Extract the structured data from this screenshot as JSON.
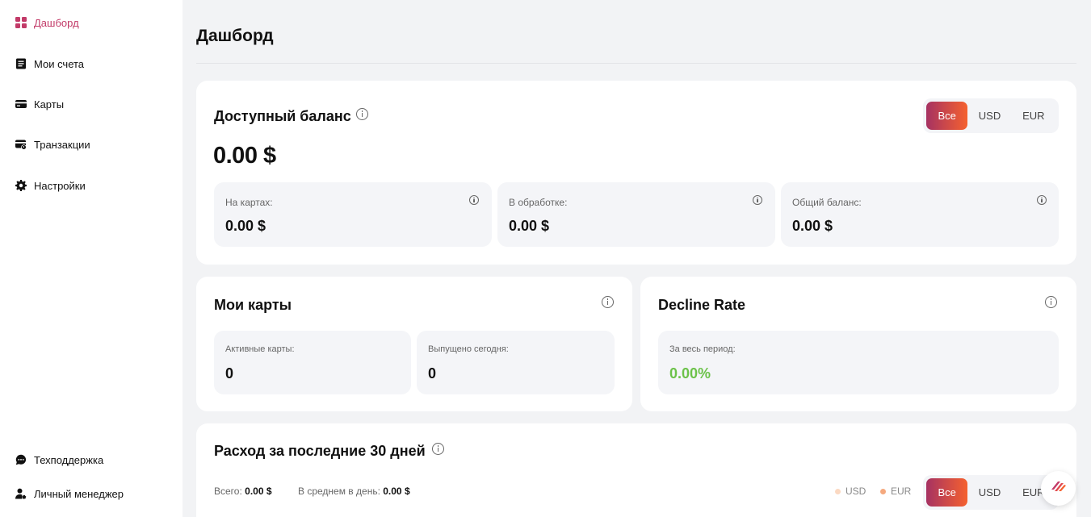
{
  "sidebar": {
    "items": [
      {
        "label": "Дашборд",
        "icon": "dashboard-icon",
        "active": true
      },
      {
        "label": "Мои счета",
        "icon": "accounts-icon"
      },
      {
        "label": "Карты",
        "icon": "card-icon"
      },
      {
        "label": "Транзакции",
        "icon": "transactions-icon"
      },
      {
        "label": "Настройки",
        "icon": "gear-icon"
      }
    ],
    "bottom": [
      {
        "label": "Техподдержка",
        "icon": "chat-icon"
      },
      {
        "label": "Личный менеджер",
        "icon": "manager-icon"
      }
    ]
  },
  "page": {
    "title": "Дашборд"
  },
  "balance": {
    "title": "Доступный баланс",
    "total": "0.00 $",
    "currency_tabs": [
      "Все",
      "USD",
      "EUR"
    ],
    "selected_tab": "Все",
    "stats": [
      {
        "label": "На картах:",
        "value": "0.00 $"
      },
      {
        "label": "В обработке:",
        "value": "0.00 $"
      },
      {
        "label": "Общий баланс:",
        "value": "0.00 $"
      }
    ]
  },
  "cards": {
    "title": "Мои карты",
    "stats": [
      {
        "label": "Активные карты:",
        "value": "0"
      },
      {
        "label": "Выпущено сегодня:",
        "value": "0"
      }
    ]
  },
  "decline": {
    "title": "Decline Rate",
    "stat": {
      "label": "За весь период:",
      "value": "0.00%"
    }
  },
  "spend": {
    "title": "Расход за последние 30 дней",
    "total_label": "Всего:",
    "total_value": "0.00 $",
    "avg_label": "В среднем в день:",
    "avg_value": "0.00 $",
    "legend": [
      {
        "label": "USD",
        "color": "#fbd9c2"
      },
      {
        "label": "EUR",
        "color": "#f5a97e"
      }
    ],
    "currency_tabs": [
      "Все",
      "USD",
      "EUR"
    ],
    "selected_tab": "Все"
  },
  "colors": {
    "accent_start": "#a63262",
    "accent_end": "#f5612f",
    "active_nav": "#c23a68",
    "positive": "#6cc24a"
  }
}
